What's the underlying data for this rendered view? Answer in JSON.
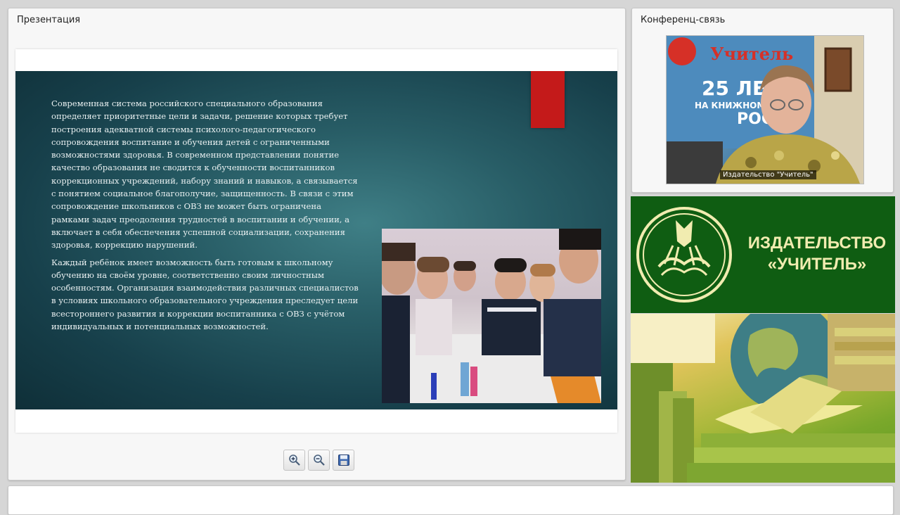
{
  "presentation": {
    "title": "Презентация",
    "slide": {
      "paragraphs": [
        "Современная система российского специального образования определяет приоритетные цели и задачи, решение которых требует построения адекватной системы психолого-педагогического сопровождения воспитание и обучения детей с ограниченными возможностями здоровья. В современном представлении понятие качество образования не сводится к обученности воспитанников коррекционных учреждений, набору знаний и навыков, а связывается с понятием социальное благополучие, защищенность. В связи с этим сопровождение школьников с ОВЗ не может быть ограничена рамками задач преодоления трудностей в воспитании и обучении, а включает в себя обеспечения успешной социализации, сохранения здоровья, коррекцию нарушений.",
        "Каждый ребёнок имеет возможность быть готовым к школьному обучению на своём уровне, соответственно своим личностным особенностям. Организация взаимодействия различных специалистов в условиях школьного образовательного учреждения преследует цели всестороннего развития и коррекции воспитанника с ОВЗ с учётом индивидуальных и потенциальных возможностей."
      ],
      "accent_color": "#c41a1a"
    },
    "tools": [
      {
        "name": "zoom-in",
        "icon": "zoom-in-icon"
      },
      {
        "name": "zoom-out",
        "icon": "zoom-out-icon"
      },
      {
        "name": "save",
        "icon": "floppy-disk-icon"
      }
    ]
  },
  "conference": {
    "title": "Конференц-связь",
    "participant_label": "Издательство \"Учитель\"",
    "poster_text": {
      "brand": "Учитель",
      "years": "25 ЛЕТ",
      "line1": "НА КНИЖНОМ",
      "line2": "РОС"
    }
  },
  "brand": {
    "line1": "ИЗДАТЕЛЬСТВО",
    "line2": "«УЧИТЕЛЬ»",
    "text_color": "#f1ecb0",
    "bg_color": "#0f5d12"
  }
}
